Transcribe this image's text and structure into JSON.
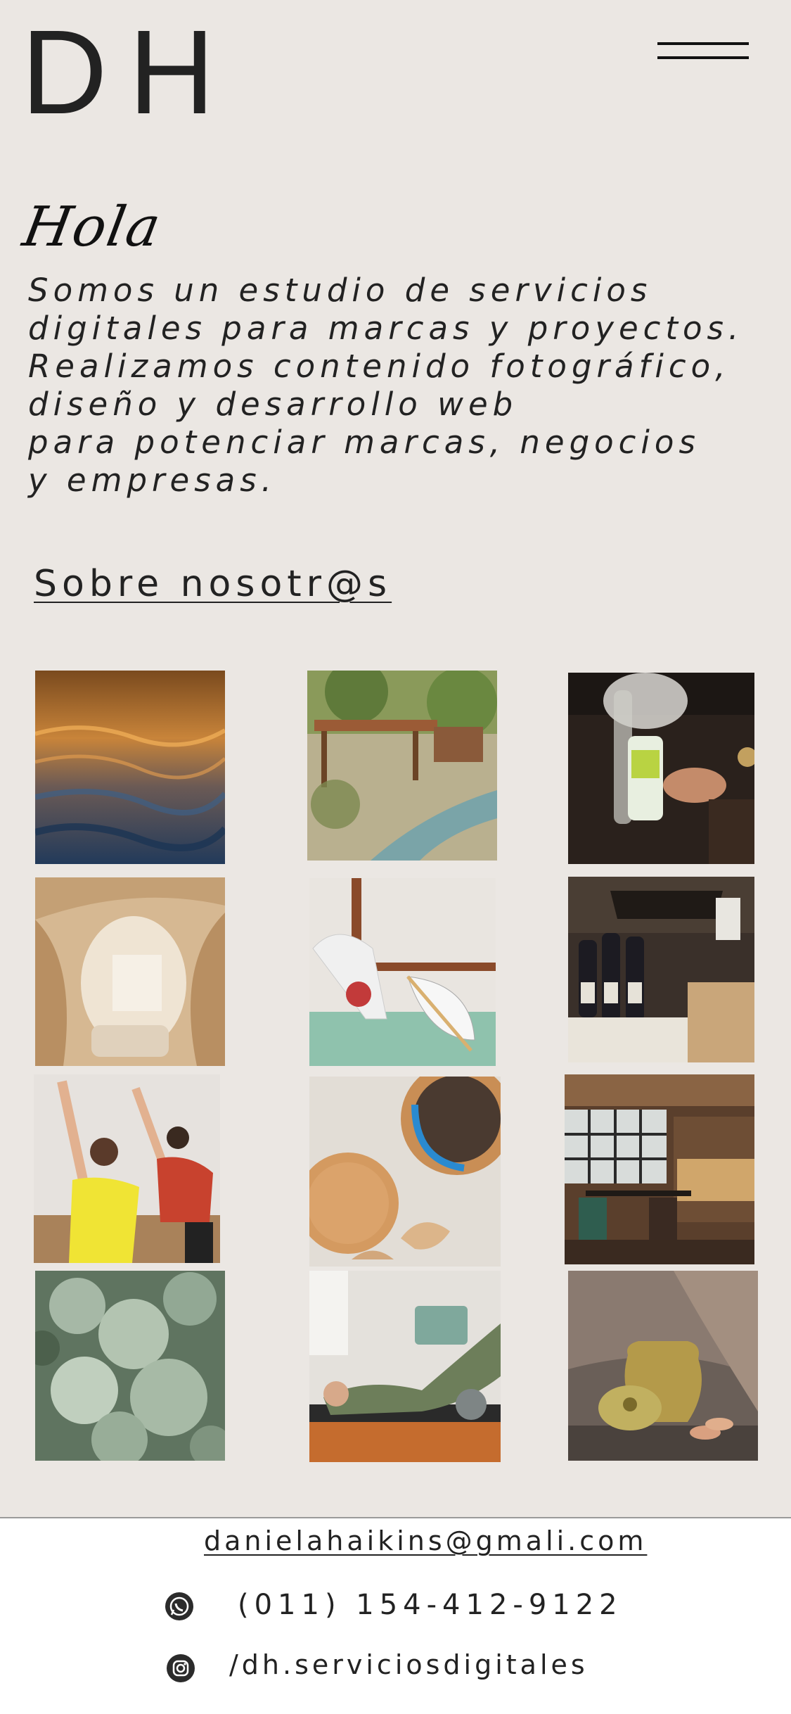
{
  "header": {
    "logo_text": "DH",
    "menu_icon": "hamburger-menu-icon"
  },
  "intro": {
    "greeting": "Hola",
    "lines": [
      "Somos un estudio de servicios",
      "digitales para marcas y proyectos.",
      "Realizamos contenido fotográfico,",
      "diseño y desarrollo web",
      "para potenciar marcas, negocios",
      "y empresas."
    ]
  },
  "about": {
    "link_label": "Sobre nosotr@s"
  },
  "gallery": {
    "photos": [
      "ocean-sunset-waves",
      "garden-pergola-path",
      "wine-bottle-hand-pouring",
      "curved-wood-lobby",
      "dancer-with-fan",
      "wine-bottles-press",
      "dancers-arms-raised",
      "ceramic-plates-bowl",
      "restaurant-interior",
      "green-leaves-closeup",
      "pilates-reformer",
      "ceramic-jar-lid"
    ]
  },
  "footer": {
    "email": "danielahaikins@gmali.com",
    "phone": "(011) 154-412-9122",
    "instagram": "/dh.serviciosdigitales",
    "phone_icon": "whatsapp-icon",
    "instagram_icon": "instagram-icon"
  }
}
